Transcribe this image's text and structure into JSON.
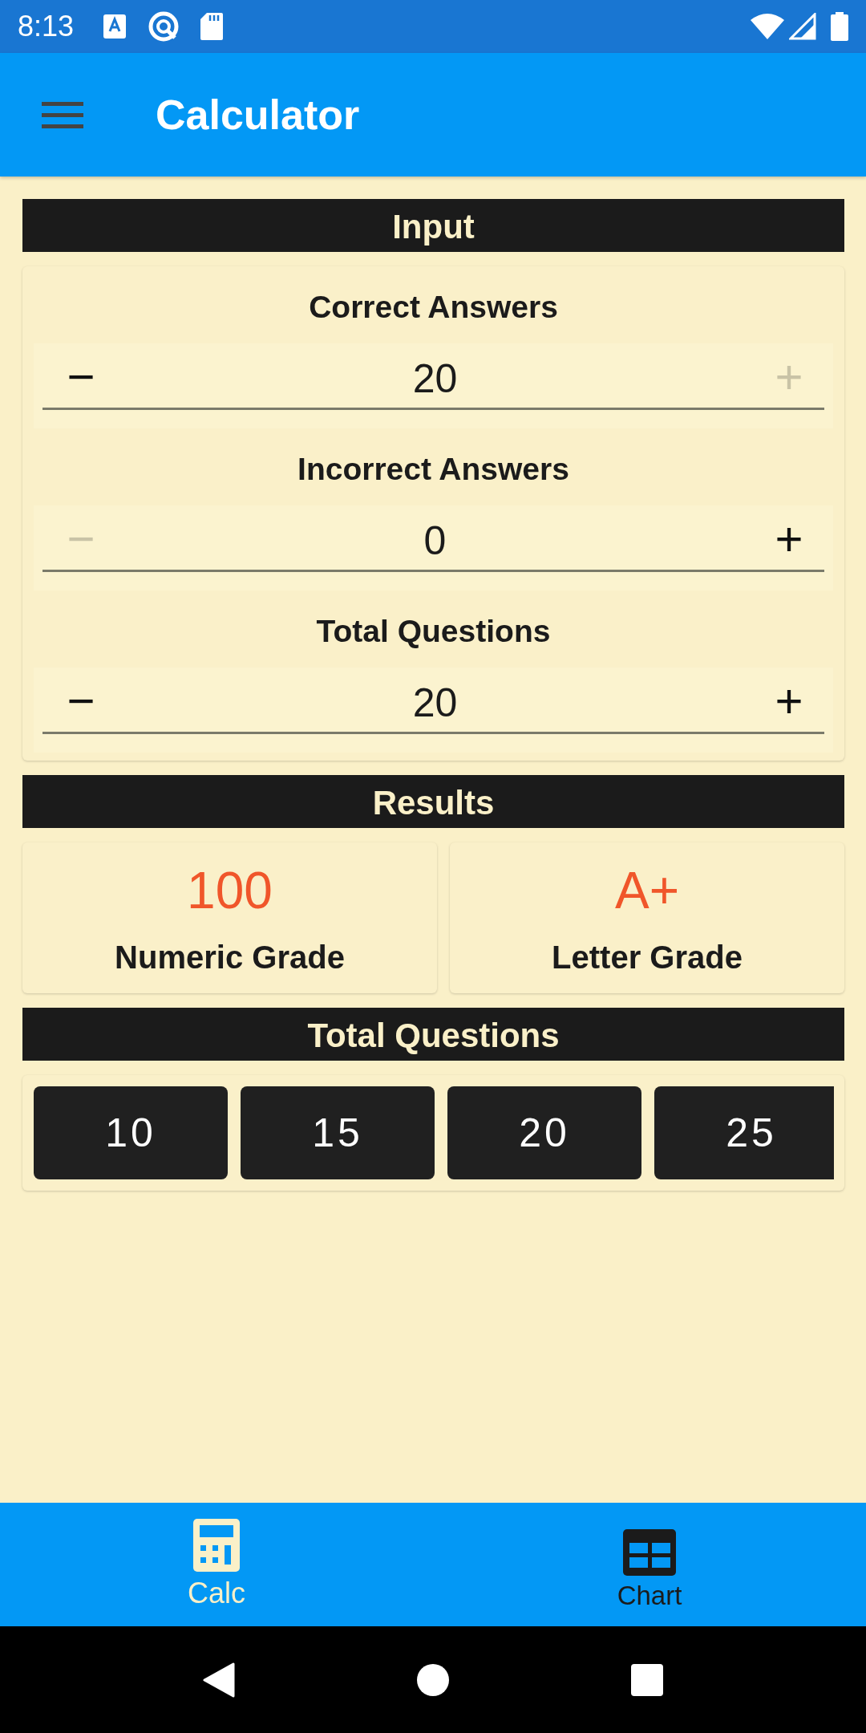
{
  "status_bar": {
    "time": "8:13"
  },
  "app_bar": {
    "title": "Calculator"
  },
  "input": {
    "header": "Input",
    "steppers": [
      {
        "label": "Correct Answers",
        "value": "20",
        "decrement": {
          "symbol": "−",
          "disabled": false
        },
        "increment": {
          "symbol": "+",
          "disabled": true
        }
      },
      {
        "label": "Incorrect Answers",
        "value": "0",
        "decrement": {
          "symbol": "−",
          "disabled": true
        },
        "increment": {
          "symbol": "+",
          "disabled": false
        }
      },
      {
        "label": "Total Questions",
        "value": "20",
        "decrement": {
          "symbol": "−",
          "disabled": false
        },
        "increment": {
          "symbol": "+",
          "disabled": false
        }
      }
    ]
  },
  "results": {
    "header": "Results",
    "cards": [
      {
        "value": "100",
        "label": "Numeric Grade"
      },
      {
        "value": "A+",
        "label": "Letter Grade"
      }
    ]
  },
  "presets": {
    "header": "Total Questions",
    "buttons": [
      "10",
      "15",
      "20",
      "25"
    ]
  },
  "bottom_nav": {
    "tabs": [
      {
        "label": "Calc",
        "selected": true
      },
      {
        "label": "Chart",
        "selected": false
      }
    ]
  }
}
